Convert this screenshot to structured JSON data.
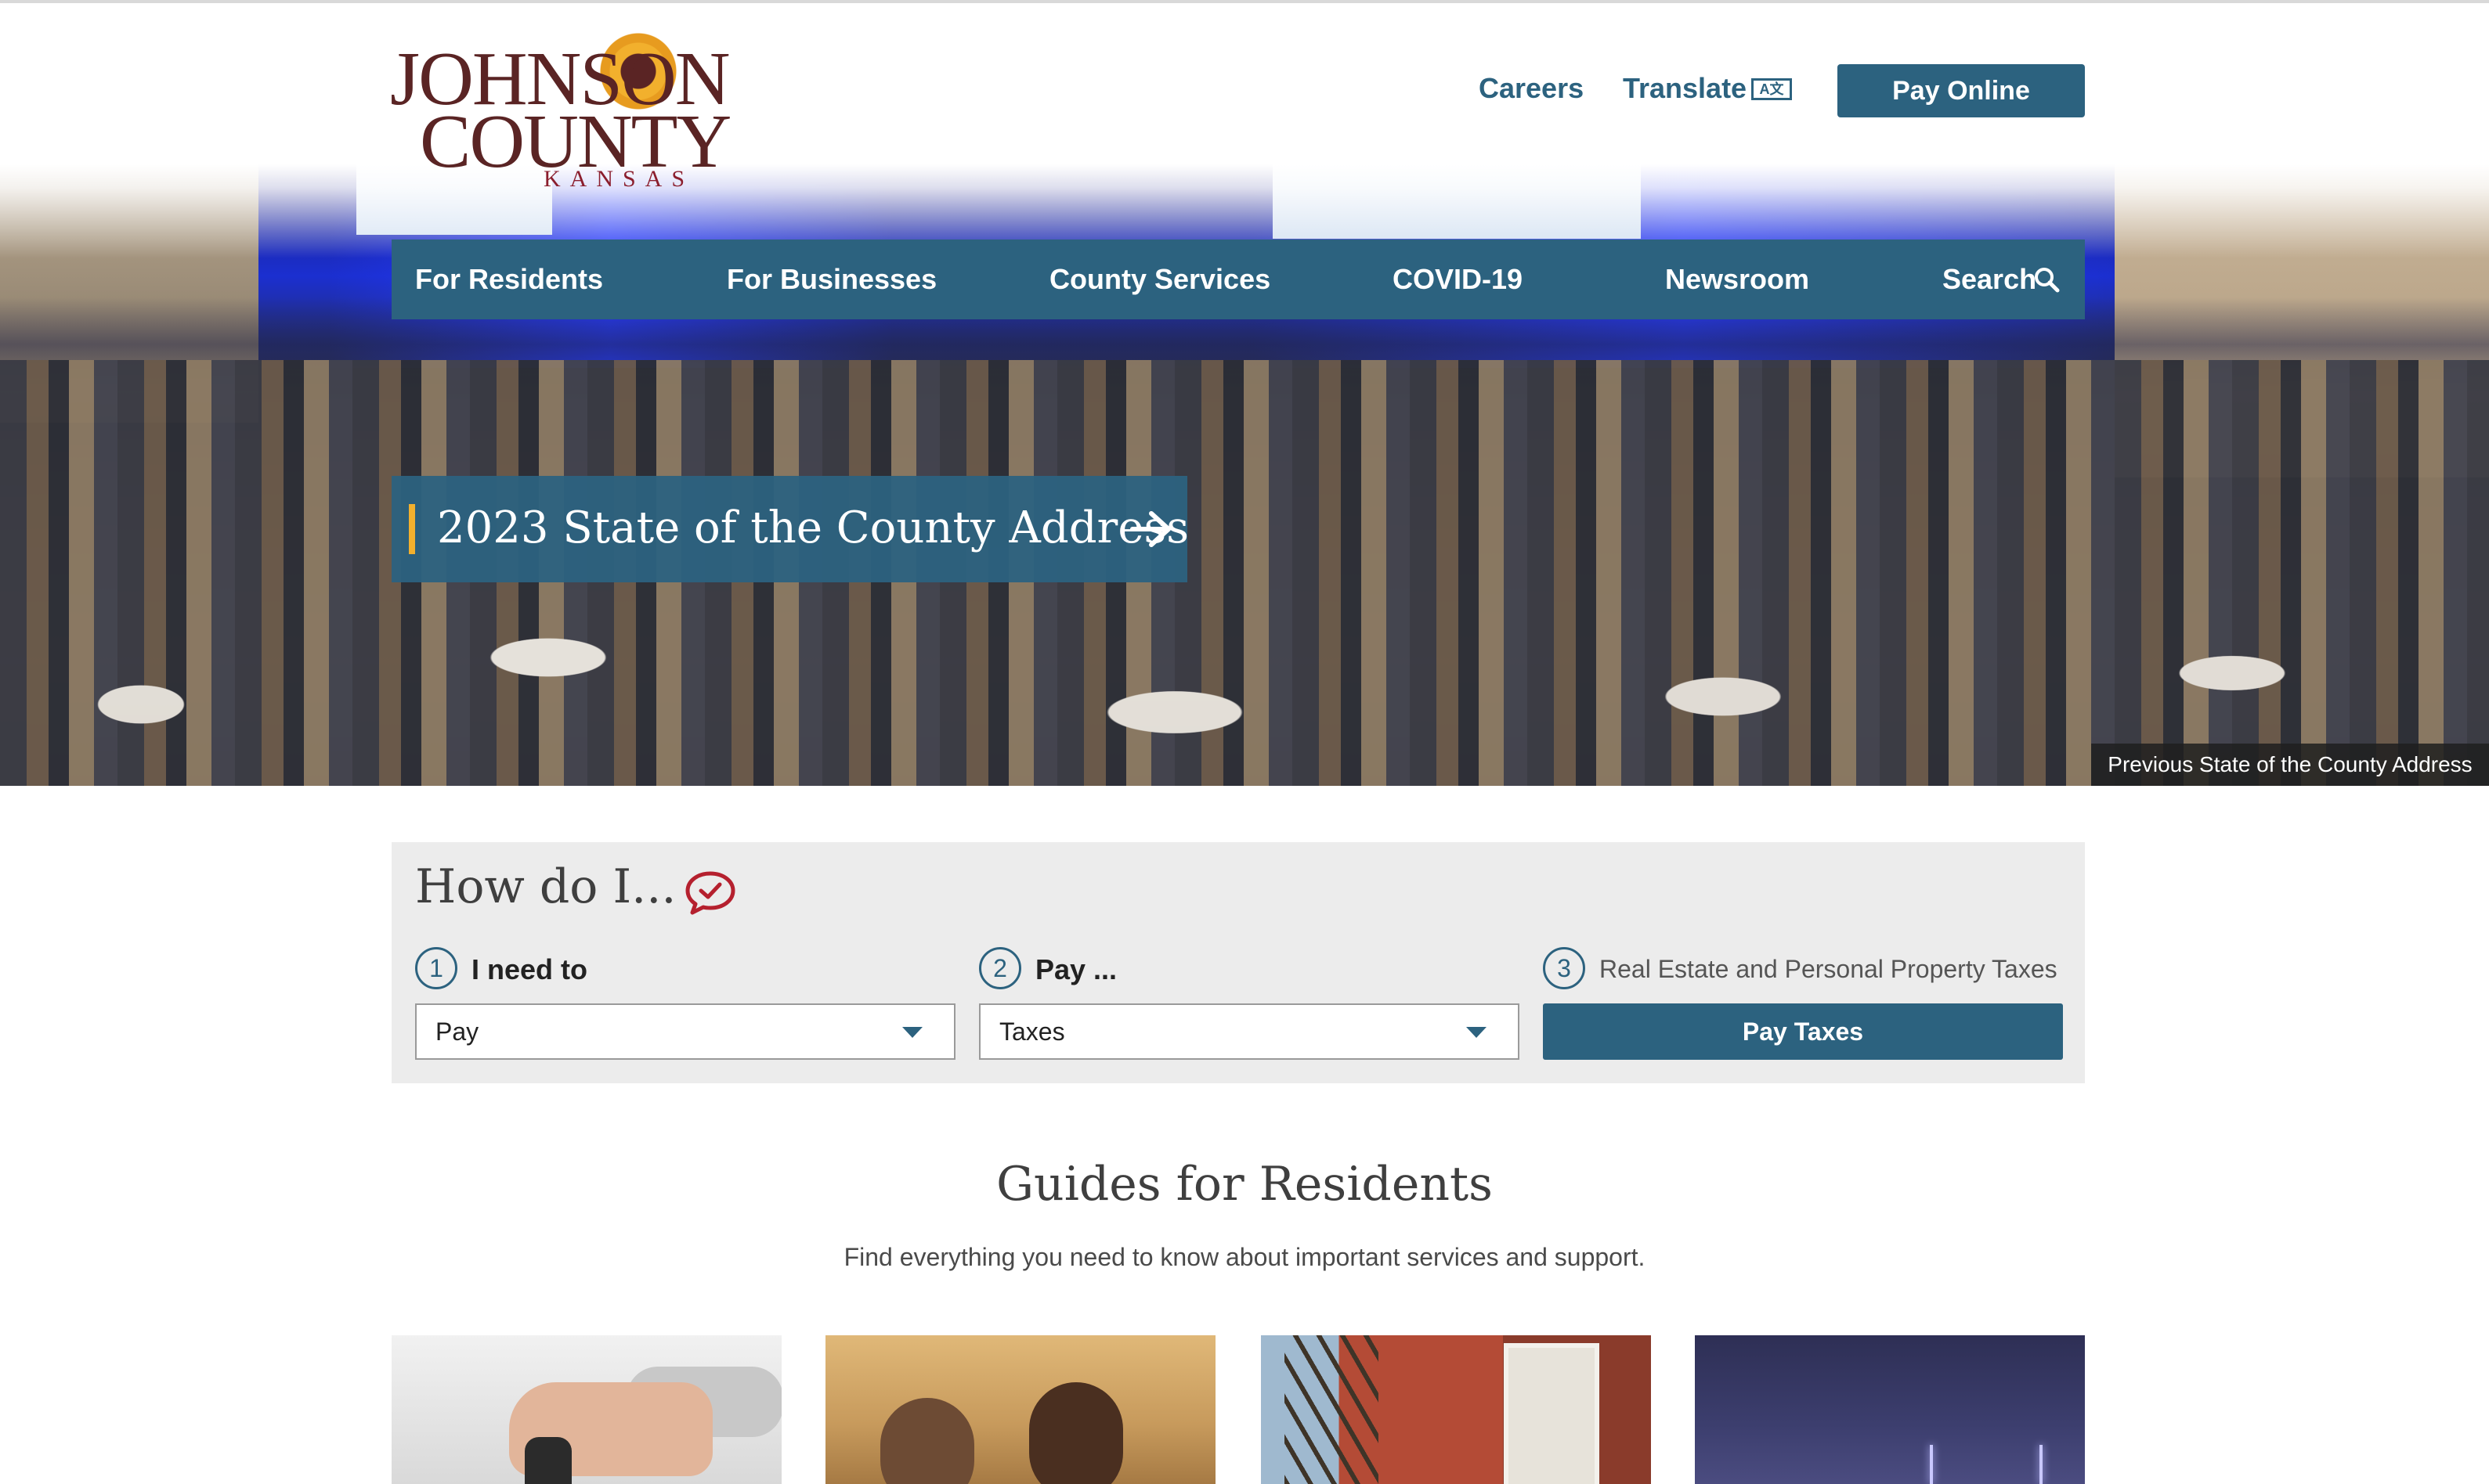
{
  "header": {
    "logo_line1": "JOHNSON",
    "logo_line2": "COUNTY",
    "logo_sub": "KANSAS",
    "careers": "Careers",
    "translate": "Translate",
    "translate_icon": "A文",
    "pay_online": "Pay Online"
  },
  "nav": {
    "items": [
      "For Residents",
      "For Businesses",
      "County Services",
      "COVID-19",
      "Newsroom",
      "Search"
    ]
  },
  "hero": {
    "cta_label": "2023 State of the County Address",
    "caption": "Previous State of the County Address"
  },
  "how_do_i": {
    "title": "How do I...",
    "step1_num": "1",
    "step1_label": "I need to",
    "step1_value": "Pay",
    "step2_num": "2",
    "step2_label": "Pay ...",
    "step2_value": "Taxes",
    "step3_num": "3",
    "step3_label": "Real Estate and Personal Property Taxes",
    "action_button": "Pay Taxes"
  },
  "guides": {
    "title": "Guides for Residents",
    "subtitle": "Find everything you need to know about important services and support."
  },
  "colors": {
    "primary": "#2c627f",
    "accent": "#f2b02d",
    "logo_maroon": "#5a2424"
  },
  "icons": [
    "search-icon",
    "translate-icon",
    "arrow-right-icon",
    "chat-check-icon",
    "chevron-down-icon"
  ]
}
